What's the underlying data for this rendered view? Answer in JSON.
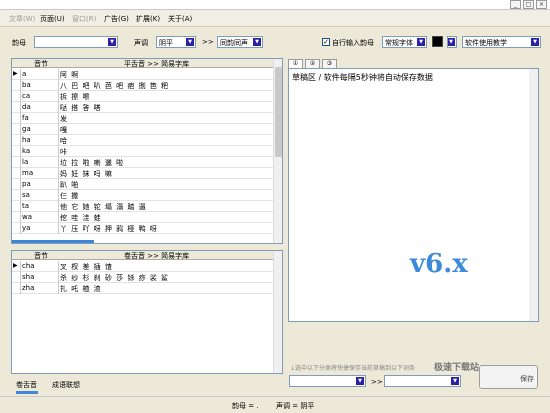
{
  "window": {
    "controls": [
      "_",
      "□",
      "×"
    ]
  },
  "menu": {
    "items": [
      "文章(W)",
      "页面(U)",
      "窗口(R)",
      "广告(G)",
      "扩展(K)",
      "关于(A)"
    ]
  },
  "toolbar": {
    "yunmu_label": "韵母",
    "shengdiao_label": "声调",
    "shengdiao_value": "阴平",
    "arrows": ">>",
    "tongyun_value": "同韵同声",
    "auto_input_label": "自行输入韵母",
    "font_value": "常规字体",
    "tutorial_value": "软件使用教学"
  },
  "upper_grid": {
    "headers": [
      "音节",
      "平舌音 >> 简易字库"
    ],
    "rows": [
      {
        "py": "a",
        "ch": "阿 啊"
      },
      {
        "py": "ba",
        "ch": "八 巴 吧 叭 芭 吧 疤 捌 笆 粑"
      },
      {
        "py": "ca",
        "ch": "拆 擦 嚓"
      },
      {
        "py": "da",
        "ch": "哒 搭 答 嗒"
      },
      {
        "py": "fa",
        "ch": "发"
      },
      {
        "py": "ga",
        "ch": "嘎"
      },
      {
        "py": "ha",
        "ch": "哈"
      },
      {
        "py": "ka",
        "ch": "咔"
      },
      {
        "py": "la",
        "ch": "垃 拉 啦 喇 邋 啦"
      },
      {
        "py": "ma",
        "ch": "妈 妊 抹 吗 嘛"
      },
      {
        "py": "pa",
        "ch": "趴 啪"
      },
      {
        "py": "sa",
        "ch": "仨 撒"
      },
      {
        "py": "ta",
        "ch": "他 它 她 铊 塌 溻 踏 遢"
      },
      {
        "py": "wa",
        "ch": "挖 哇 洼 蛙"
      },
      {
        "py": "ya",
        "ch": "丫 压 吖 呀 押 鸦 桠 鸭 呀"
      }
    ]
  },
  "lower_grid": {
    "headers": [
      "音节",
      "卷舌音 >> 简易字库"
    ],
    "rows": [
      {
        "py": "cha",
        "ch": "叉 杈 差 插 馇"
      },
      {
        "py": "sha",
        "ch": "杀 纱 杉 刹 砂 莎 铩 痧 裟 鲨"
      },
      {
        "py": "zha",
        "ch": "扎 吒 楂 渣"
      }
    ]
  },
  "editor": {
    "tabs": [
      "①",
      "②",
      "③"
    ],
    "content": "草稿区 / 软件每隔5秒钟将自动保存数据",
    "version": "v6.x"
  },
  "bottom": {
    "hint": "↓选中以下分类将快捷保存当前草稿到以下词条",
    "arrows": ">>",
    "save_label": "保存",
    "watermark": "极速下载站"
  },
  "left_tabs": [
    "卷舌音",
    "成语联想"
  ],
  "status": {
    "yunmu": "韵母 = .",
    "shengdiao": "声调 = 阴平"
  },
  "colors": {
    "accent": "#3c8ad8",
    "dropdown_arrow": "#2d1fa6"
  }
}
